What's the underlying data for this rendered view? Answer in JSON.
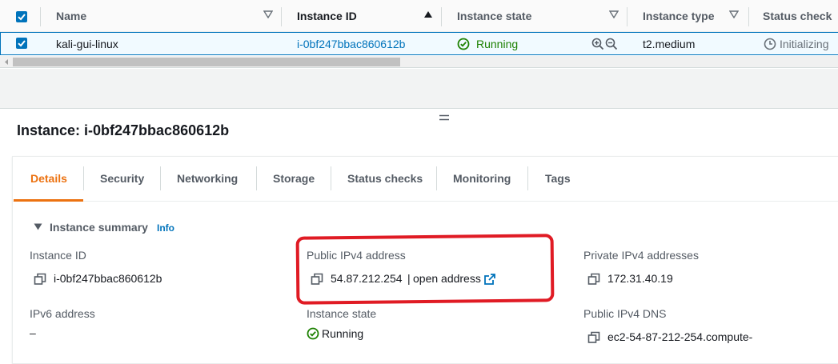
{
  "table": {
    "columns": [
      "Name",
      "Instance ID",
      "Instance state",
      "Instance type",
      "Status check"
    ],
    "row": {
      "name": "kali-gui-linux",
      "instance_id": "i-0bf247bbac860612b",
      "state": "Running",
      "type": "t2.medium",
      "status_check": "Initializing"
    }
  },
  "detail": {
    "title": "Instance: i-0bf247bbac860612b",
    "tabs": [
      "Details",
      "Security",
      "Networking",
      "Storage",
      "Status checks",
      "Monitoring",
      "Tags"
    ],
    "active_tab": "Details",
    "summary_heading": "Instance summary",
    "info_link": "Info",
    "fields": {
      "instance_id_label": "Instance ID",
      "instance_id_value": "i-0bf247bbac860612b",
      "public_ipv4_label": "Public IPv4 address",
      "public_ipv4_value": "54.87.212.254",
      "public_ipv4_separator": "|",
      "open_address": "open address",
      "private_ipv4_label": "Private IPv4 addresses",
      "private_ipv4_value": "172.31.40.19",
      "ipv6_label": "IPv6 address",
      "ipv6_value": "–",
      "instance_state_label": "Instance state",
      "instance_state_value": "Running",
      "public_dns_label": "Public IPv4 DNS",
      "public_dns_value": "ec2-54-87-212-254.compute-"
    }
  },
  "colors": {
    "accent": "#0073bb",
    "running": "#1d8102",
    "active_tab": "#ec7211",
    "annotation": "#e01b24"
  },
  "icons": [
    "checkbox-checked-icon",
    "filter-caret-icon",
    "sort-ascending-icon",
    "status-running-icon",
    "zoom-in-icon",
    "zoom-out-icon",
    "status-initializing-icon",
    "copy-icon",
    "external-link-icon",
    "collapse-caret-icon",
    "resize-handle-icon"
  ]
}
